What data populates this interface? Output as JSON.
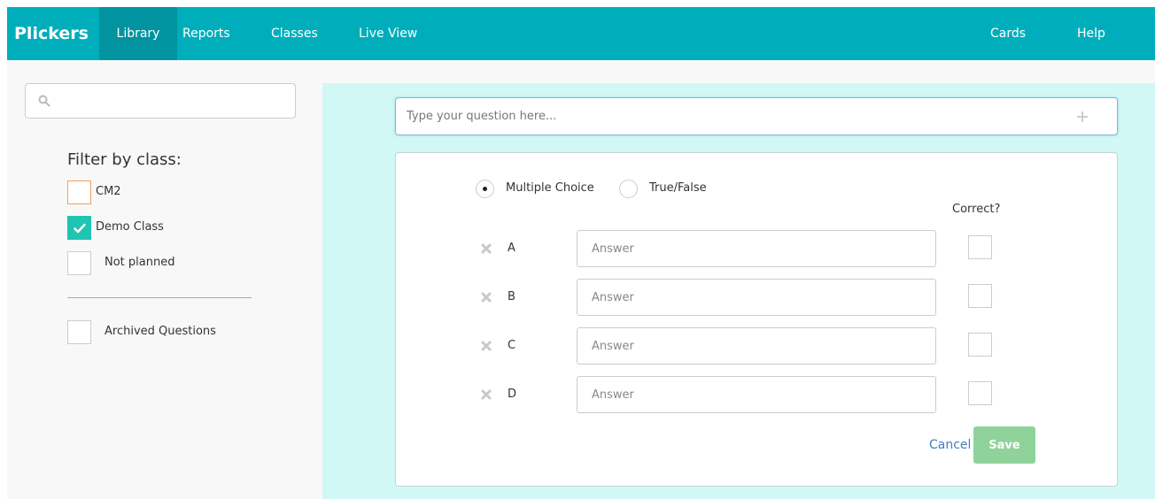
{
  "topbar": {
    "brand": "Plickers",
    "nav": [
      "Library",
      "Reports",
      "Classes",
      "Live View"
    ],
    "cards": "Cards",
    "help": "Help"
  },
  "colors": {
    "topbar": "#00aebb",
    "active_tab": "#01939f",
    "editor_bg": "#d2f8f5",
    "checked": "#20c4b0",
    "save": "#8fd39a",
    "link": "#3f7ec0"
  },
  "sidebar": {
    "search_icon": "search-icon",
    "filter_title": "Filter by class:",
    "classes": [
      {
        "label": "CM2",
        "checked": false
      },
      {
        "label": "Demo Class",
        "checked": true
      },
      {
        "label": "Not planned",
        "checked": false
      }
    ],
    "archived": "Archived Questions"
  },
  "editor": {
    "question_placeholder": "Type your question here...",
    "types": [
      "Multiple Choice",
      "True/False"
    ],
    "selected_type": "Multiple Choice",
    "correct_label": "Correct?",
    "answers": [
      {
        "letter": "A",
        "placeholder": "Answer"
      },
      {
        "letter": "B",
        "placeholder": "Answer"
      },
      {
        "letter": "C",
        "placeholder": "Answer"
      },
      {
        "letter": "D",
        "placeholder": "Answer"
      }
    ],
    "cancel": "Cancel",
    "save": "Save"
  }
}
